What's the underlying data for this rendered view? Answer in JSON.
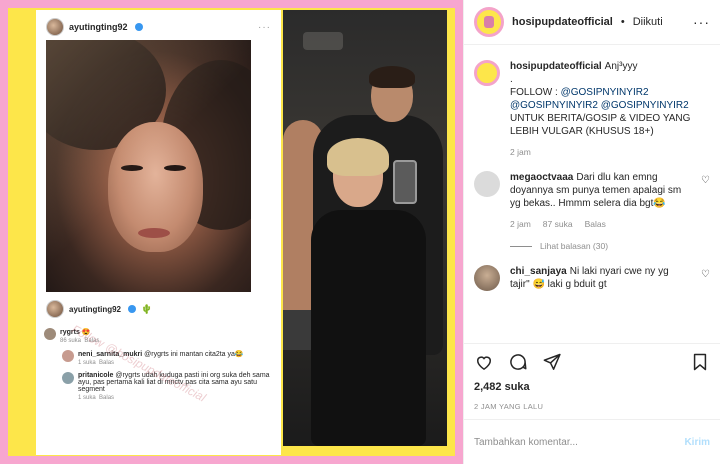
{
  "screenshot": {
    "account": "ayutingting92",
    "caption_emoji": "🌵",
    "comments": [
      {
        "user": "rygrts",
        "text": "😍",
        "likes_text": "86 suka",
        "reply": "Balas"
      },
      {
        "user": "neni_sarnita_mukri",
        "text": "@rygrts ini mantan cita2ta ya😂",
        "likes_text": "1 suka",
        "reply": "Balas"
      },
      {
        "user": "pritanicole",
        "text": "@rygrts udah kuduga pasti ini org suka deh sama ayu, pas pertama kali liat di mnctv pas cita sama ayu satu segment",
        "likes_text": "1 suka",
        "reply": "Balas"
      }
    ],
    "watermark": "Follow @hosipupdateofficial"
  },
  "header": {
    "username": "hosipupdateofficial",
    "separator": "•",
    "follow_status": "Diikuti"
  },
  "caption": {
    "username": "hosipupdateofficial",
    "text_lines": [
      "Anj³yyy",
      "."
    ],
    "follow_label": "FOLLOW : ",
    "mention1": "@GOSIPNYINYIR2",
    "mention2": "@GOSIPNYINYIR2",
    "mention3": "@GOSIPNYINYIR2",
    "rest": " UNTUK BERITA/GOSIP & VIDEO YANG LEBIH VULGAR (KHUSUS 18+)",
    "time": "2 jam"
  },
  "comments": [
    {
      "username": "megaoctvaaa",
      "text": "Dari dlu kan emng doyannya sm punya temen apalagi sm yg bekas.. Hmmm selera dia bgt😂",
      "time": "2 jam",
      "likes": "87 suka",
      "reply": "Balas",
      "view_replies": "Lihat balasan (30)"
    },
    {
      "username": "chi_sanjaya",
      "text": "Ni laki nyari cwe ny yg tajir\" 😅 laki g bduit gt"
    }
  ],
  "likes": "2,482 suka",
  "timestamp": "2 JAM YANG LALU",
  "add_comment": {
    "placeholder": "Tambahkan komentar...",
    "send": "Kirim"
  },
  "colors": {
    "frame_pink": "#f7a6cf",
    "frame_yellow": "#fde64a",
    "link": "#00376b",
    "meta": "#8e8e8e",
    "send_disabled": "#b2dffc"
  },
  "icons": [
    "more-options-icon",
    "heart-icon",
    "comment-icon",
    "share-icon",
    "bookmark-icon",
    "verified-icon",
    "cactus-icon"
  ]
}
